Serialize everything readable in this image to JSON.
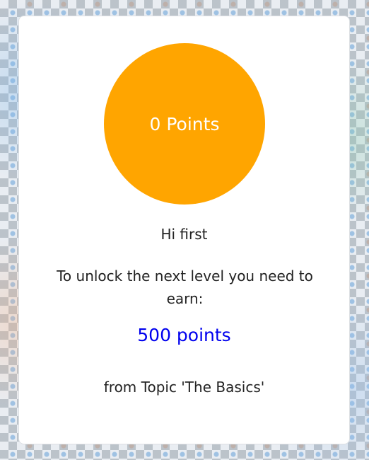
{
  "points_display": "0 Points",
  "greeting": "Hi first",
  "unlock_message": "To unlock the next level you need to earn:",
  "required_points": "500 points",
  "topic_line": "from Topic 'The Basics'",
  "colors": {
    "circle": "#ffa500",
    "required_points": "#0000ee"
  }
}
